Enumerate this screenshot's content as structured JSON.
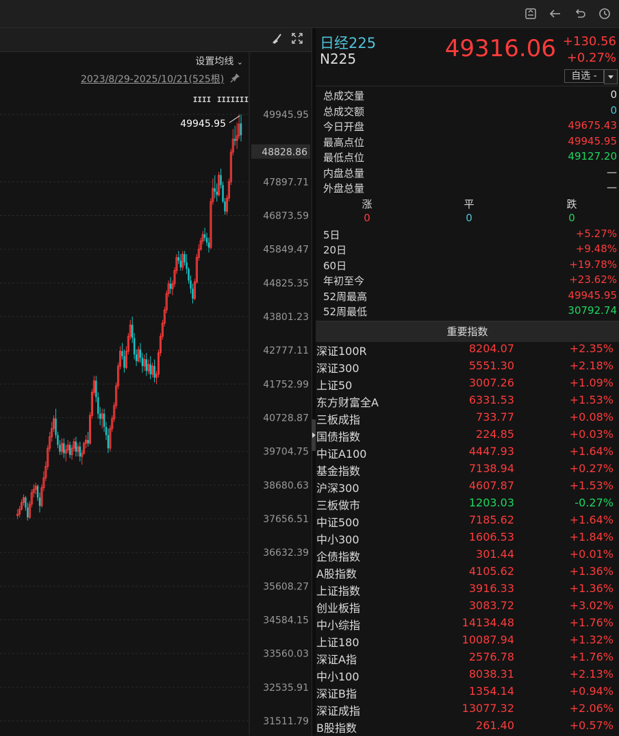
{
  "colors": {
    "up": "#ff3b3b",
    "down": "#19c6c6",
    "flat": "#4fc3d9",
    "bg": "#141414"
  },
  "toolbar": {
    "icons": [
      "export-icon",
      "back-arrow-icon",
      "undo-icon",
      "history-icon"
    ]
  },
  "chart_header": {
    "icons": [
      "brush-icon",
      "expand-icon"
    ],
    "set_ma_label": "设置均线",
    "range_label": "2023/8/29-2025/10/21(525根)",
    "tag_a": "IIII",
    "tag_b": "IIIIIII"
  },
  "quote": {
    "name": "日经225",
    "code": "N225",
    "price": "49316.06",
    "change": "+130.56",
    "change_pct": "+0.27%",
    "watch_label": "自选 -"
  },
  "stats": [
    {
      "label": "总成交量",
      "value": "0",
      "color": "white"
    },
    {
      "label": "总成交额",
      "value": "0",
      "color": "cyan"
    },
    {
      "label": "今日开盘",
      "value": "49675.43",
      "color": "red"
    },
    {
      "label": "最高点位",
      "value": "49945.95",
      "color": "red"
    },
    {
      "label": "最低点位",
      "value": "49127.20",
      "color": "green"
    },
    {
      "label": "内盘总量",
      "value": "—",
      "color": "white"
    },
    {
      "label": "外盘总量",
      "value": "—",
      "color": "white"
    }
  ],
  "breadth": {
    "headers": [
      "涨",
      "平",
      "跌"
    ],
    "counts": [
      "0",
      "0",
      "0"
    ]
  },
  "periods": [
    {
      "label": "5日",
      "value": "+5.27%",
      "color": "red"
    },
    {
      "label": "20日",
      "value": "+9.48%",
      "color": "red"
    },
    {
      "label": "60日",
      "value": "+19.78%",
      "color": "red"
    },
    {
      "label": "年初至今",
      "value": "+23.62%",
      "color": "red"
    },
    {
      "label": "52周最高",
      "value": "49945.95",
      "color": "red"
    },
    {
      "label": "52周最低",
      "value": "30792.74",
      "color": "green"
    }
  ],
  "indices_title": "重要指数",
  "indices": [
    {
      "name": "深证100R",
      "price": "8204.07",
      "chg": "+2.35%",
      "color": "red"
    },
    {
      "name": "深证300",
      "price": "5551.30",
      "chg": "+2.18%",
      "color": "red"
    },
    {
      "name": "上证50",
      "price": "3007.26",
      "chg": "+1.09%",
      "color": "red"
    },
    {
      "name": "东方财富全A",
      "price": "6331.53",
      "chg": "+1.53%",
      "color": "red"
    },
    {
      "name": "三板成指",
      "price": "733.77",
      "chg": "+0.08%",
      "color": "red"
    },
    {
      "name": "国债指数",
      "price": "224.85",
      "chg": "+0.03%",
      "color": "red"
    },
    {
      "name": "中证A100",
      "price": "4447.93",
      "chg": "+1.64%",
      "color": "red"
    },
    {
      "name": "基金指数",
      "price": "7138.94",
      "chg": "+0.27%",
      "color": "red"
    },
    {
      "name": "沪深300",
      "price": "4607.87",
      "chg": "+1.53%",
      "color": "red"
    },
    {
      "name": "三板做市",
      "price": "1203.03",
      "chg": "-0.27%",
      "color": "green"
    },
    {
      "name": "中证500",
      "price": "7185.62",
      "chg": "+1.64%",
      "color": "red"
    },
    {
      "name": "中小300",
      "price": "1606.53",
      "chg": "+1.84%",
      "color": "red"
    },
    {
      "name": "企债指数",
      "price": "301.44",
      "chg": "+0.01%",
      "color": "red"
    },
    {
      "name": "A股指数",
      "price": "4105.62",
      "chg": "+1.36%",
      "color": "red"
    },
    {
      "name": "上证指数",
      "price": "3916.33",
      "chg": "+1.36%",
      "color": "red"
    },
    {
      "name": "创业板指",
      "price": "3083.72",
      "chg": "+3.02%",
      "color": "red"
    },
    {
      "name": "中小综指",
      "price": "14134.48",
      "chg": "+1.76%",
      "color": "red"
    },
    {
      "name": "上证180",
      "price": "10087.94",
      "chg": "+1.32%",
      "color": "red"
    },
    {
      "name": "深证A指",
      "price": "2576.78",
      "chg": "+1.76%",
      "color": "red"
    },
    {
      "name": "中小100",
      "price": "8038.31",
      "chg": "+2.13%",
      "color": "red"
    },
    {
      "name": "深证B指",
      "price": "1354.14",
      "chg": "+0.94%",
      "color": "red"
    },
    {
      "name": "深证成指",
      "price": "13077.32",
      "chg": "+2.06%",
      "color": "red"
    },
    {
      "name": "B股指数",
      "price": "261.40",
      "chg": "+0.57%",
      "color": "red"
    }
  ],
  "chart_data": {
    "type": "candlestick",
    "title": "",
    "ylim": [
      31511.79,
      49945.95
    ],
    "y_ticks": [
      "49945.95",
      "47897.71",
      "46873.59",
      "45849.47",
      "44825.35",
      "43801.23",
      "42777.11",
      "41752.99",
      "40728.87",
      "39704.75",
      "38680.63",
      "37656.51",
      "36632.39",
      "35608.27",
      "34584.15",
      "33560.03",
      "32535.91",
      "31511.79"
    ],
    "y_tick_values": [
      49945.95,
      47897.71,
      46873.59,
      45849.47,
      44825.35,
      43801.23,
      42777.11,
      41752.99,
      40728.87,
      39704.75,
      38680.63,
      37656.51,
      36632.39,
      35608.27,
      34584.15,
      33560.03,
      32535.91,
      31511.79
    ],
    "current_price_label": "48828.86",
    "current_price": 48828.86,
    "max_annotation": "49945.95",
    "max_value": 49945.95,
    "grid": true,
    "series": [
      {
        "values": [
          [
            37750,
            37950,
            37650,
            37800
          ],
          [
            37800,
            38050,
            37700,
            37950
          ],
          [
            37950,
            38250,
            37900,
            38150
          ],
          [
            38150,
            38400,
            38050,
            38300
          ],
          [
            38300,
            38350,
            37900,
            38000
          ],
          [
            38000,
            38150,
            37600,
            37700
          ],
          [
            37700,
            38200,
            37650,
            38100
          ],
          [
            38100,
            38550,
            38000,
            38450
          ],
          [
            38450,
            38700,
            38300,
            38550
          ],
          [
            38550,
            38750,
            38400,
            38650
          ],
          [
            38650,
            38700,
            38200,
            38300
          ],
          [
            38300,
            38450,
            37850,
            38050
          ],
          [
            38050,
            38700,
            38000,
            38600
          ],
          [
            38600,
            39100,
            38500,
            38900
          ],
          [
            38900,
            39400,
            38800,
            39250
          ],
          [
            39250,
            39900,
            39150,
            39800
          ],
          [
            39800,
            40300,
            39700,
            40150
          ],
          [
            40150,
            40600,
            40000,
            40400
          ],
          [
            40400,
            40800,
            40300,
            40700
          ],
          [
            40700,
            41000,
            40100,
            40200
          ],
          [
            40200,
            40300,
            39800,
            39900
          ],
          [
            39900,
            40050,
            39600,
            39700
          ],
          [
            39700,
            40100,
            39600,
            39950
          ],
          [
            39950,
            40100,
            39500,
            39650
          ],
          [
            39650,
            39900,
            39400,
            39750
          ],
          [
            39750,
            40050,
            39650,
            39900
          ],
          [
            39900,
            40000,
            39500,
            39600
          ],
          [
            39600,
            39900,
            39450,
            39800
          ],
          [
            39800,
            40100,
            39700,
            40000
          ],
          [
            40000,
            40150,
            39550,
            39700
          ],
          [
            39700,
            39950,
            39550,
            39850
          ],
          [
            39850,
            40000,
            39400,
            39550
          ],
          [
            39550,
            39750,
            39300,
            39650
          ],
          [
            39650,
            40000,
            39600,
            39950
          ],
          [
            39950,
            40200,
            39800,
            40050
          ],
          [
            40050,
            40300,
            39850,
            39950
          ],
          [
            39950,
            40900,
            39900,
            40800
          ],
          [
            40800,
            41600,
            40700,
            41500
          ],
          [
            41500,
            42000,
            41400,
            41850
          ],
          [
            41850,
            42000,
            41200,
            41350
          ],
          [
            41350,
            41500,
            40700,
            40850
          ],
          [
            40850,
            41050,
            40500,
            40700
          ],
          [
            40700,
            41000,
            40400,
            40850
          ],
          [
            40850,
            41000,
            40300,
            40450
          ],
          [
            40450,
            40600,
            40050,
            40200
          ],
          [
            40200,
            40400,
            39650,
            39800
          ],
          [
            39800,
            40500,
            39700,
            40400
          ],
          [
            40400,
            40800,
            40300,
            40700
          ],
          [
            40700,
            41200,
            40600,
            41100
          ],
          [
            41100,
            41800,
            41000,
            41700
          ],
          [
            41700,
            42400,
            41600,
            42300
          ],
          [
            42300,
            42900,
            42200,
            42750
          ],
          [
            42750,
            43000,
            42500,
            42600
          ],
          [
            42600,
            42800,
            42100,
            42250
          ],
          [
            42250,
            42900,
            42200,
            42750
          ],
          [
            42750,
            43300,
            42650,
            43200
          ],
          [
            43200,
            43700,
            43100,
            43550
          ],
          [
            43550,
            43800,
            43000,
            43150
          ],
          [
            43150,
            43300,
            42500,
            42650
          ],
          [
            42650,
            42800,
            42300,
            42450
          ],
          [
            42450,
            42900,
            42400,
            42800
          ],
          [
            42800,
            43000,
            42400,
            42550
          ],
          [
            42550,
            42700,
            42100,
            42300
          ],
          [
            42300,
            42650,
            42150,
            42500
          ],
          [
            42500,
            42700,
            42000,
            42150
          ],
          [
            42150,
            42500,
            42050,
            42350
          ],
          [
            42350,
            42600,
            41900,
            42050
          ],
          [
            42050,
            42400,
            41950,
            42300
          ],
          [
            42300,
            42500,
            41800,
            41950
          ],
          [
            41950,
            42150,
            41750,
            42050
          ],
          [
            42050,
            42800,
            41950,
            42700
          ],
          [
            42700,
            43300,
            42600,
            43200
          ],
          [
            43200,
            43700,
            43100,
            43600
          ],
          [
            43600,
            44100,
            43500,
            44000
          ],
          [
            44000,
            44600,
            43900,
            44500
          ],
          [
            44500,
            44900,
            44400,
            44800
          ],
          [
            44800,
            45000,
            44500,
            44650
          ],
          [
            44650,
            44900,
            44450,
            44800
          ],
          [
            44800,
            45300,
            44700,
            45200
          ],
          [
            45200,
            45700,
            45100,
            45600
          ],
          [
            45600,
            45800,
            45400,
            45500
          ],
          [
            45500,
            45700,
            45200,
            45300
          ],
          [
            45300,
            45800,
            45200,
            45700
          ],
          [
            45700,
            45800,
            45350,
            45450
          ],
          [
            45450,
            45700,
            45100,
            45250
          ],
          [
            45250,
            45300,
            44800,
            44900
          ],
          [
            44900,
            45050,
            44500,
            44650
          ],
          [
            44650,
            44800,
            44200,
            44350
          ],
          [
            44350,
            44950,
            44300,
            44850
          ],
          [
            44850,
            45700,
            44800,
            45600
          ],
          [
            45600,
            46000,
            45500,
            45850
          ],
          [
            45850,
            46200,
            45800,
            46100
          ],
          [
            46100,
            46400,
            46000,
            46300
          ],
          [
            46300,
            46500,
            46100,
            46200
          ],
          [
            46200,
            46350,
            45950,
            46050
          ],
          [
            46050,
            46200,
            45750,
            45900
          ],
          [
            45900,
            47400,
            45850,
            47300
          ],
          [
            47300,
            48000,
            47200,
            47700
          ],
          [
            47700,
            48100,
            47400,
            47600
          ],
          [
            47600,
            47850,
            47300,
            47500
          ],
          [
            47500,
            48200,
            47450,
            48100
          ],
          [
            48100,
            48300,
            47700,
            47800
          ],
          [
            47800,
            47900,
            47250,
            47300
          ],
          [
            47300,
            47400,
            46900,
            47000
          ],
          [
            47000,
            47500,
            46900,
            47400
          ],
          [
            47400,
            48000,
            47300,
            47900
          ],
          [
            47900,
            48900,
            47800,
            48800
          ],
          [
            48800,
            49500,
            48700,
            49200
          ],
          [
            49200,
            49600,
            49000,
            49150
          ],
          [
            49150,
            49700,
            48900,
            49300
          ],
          [
            49300,
            49946,
            49200,
            49650
          ],
          [
            49675,
            49946,
            49127,
            49316
          ]
        ]
      }
    ]
  }
}
